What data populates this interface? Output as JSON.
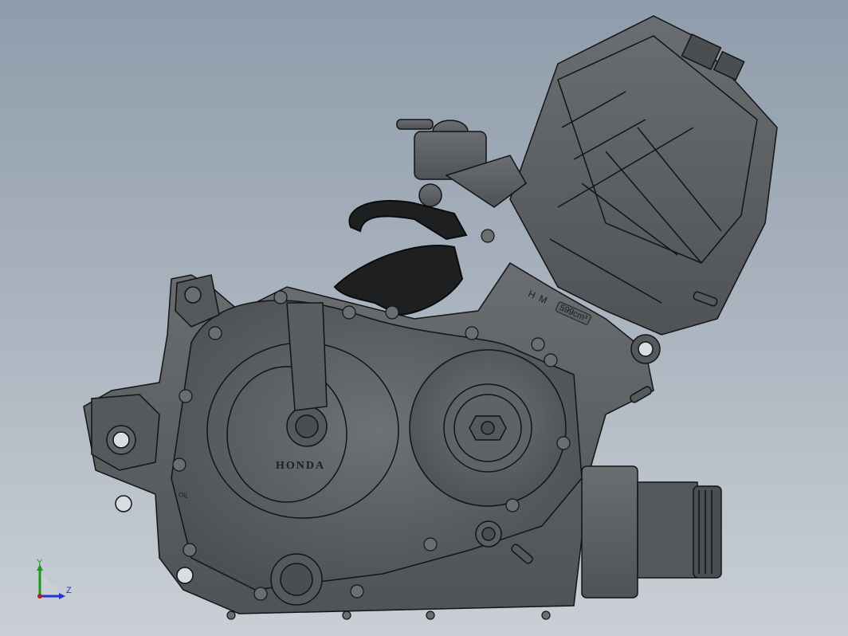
{
  "model": {
    "brand_text": "HONDA",
    "model_code": "HM",
    "displacement": "599cm³",
    "oil_label": "OIL"
  },
  "triad": {
    "y_label": "Y",
    "z_label": "Z"
  },
  "colors": {
    "background_top": "#8f9cab",
    "background_bottom": "#c9cfd5",
    "metal": "#5c6063",
    "metal_dark": "#3d4144",
    "hose": "#1d1f21",
    "edge": "#121416",
    "axis_y": "#1a9a1a",
    "axis_z": "#2233cc"
  }
}
